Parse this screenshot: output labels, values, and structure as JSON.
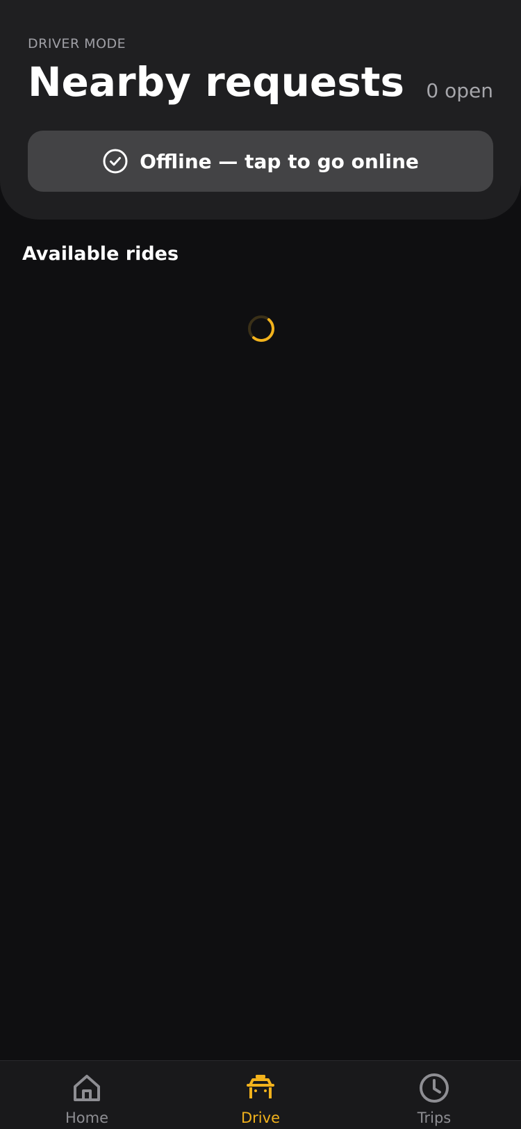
{
  "header": {
    "mode_label": "DRIVER MODE",
    "title": "Nearby requests",
    "open_count": "0 open",
    "status_button_label": "Offline — tap to go online"
  },
  "main": {
    "section_title": "Available rides",
    "loading": true
  },
  "tabbar": {
    "tabs": [
      {
        "label": "Home",
        "icon": "home-icon",
        "active": false
      },
      {
        "label": "Drive",
        "icon": "car-icon",
        "active": true
      },
      {
        "label": "Trips",
        "icon": "clock-icon",
        "active": false
      }
    ]
  },
  "colors": {
    "accent": "#f2b21c",
    "background": "#0f0f11",
    "header_bg": "#1f1f21",
    "button_bg": "#434345",
    "muted_text": "#a0a0a6"
  }
}
